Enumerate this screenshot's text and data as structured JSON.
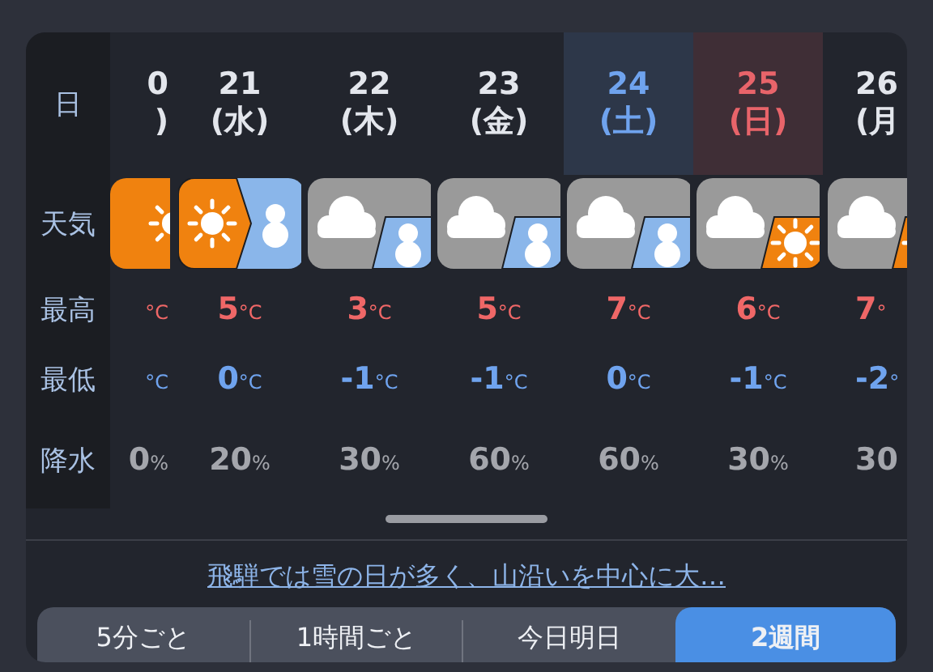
{
  "row_labels": {
    "date": "日",
    "weather": "天気",
    "high": "最高",
    "low": "最低",
    "precip": "降水"
  },
  "days": [
    {
      "day": "0",
      "weekday": ")",
      "color": "#e3e6ec",
      "kind": "sun",
      "high_unit": "°C",
      "low_unit": "°C",
      "precip": "0",
      "precip_unit": "%"
    },
    {
      "day": "21",
      "weekday": "(水)",
      "color": "#e3e6ec",
      "kind": "sun-snow",
      "high": "5",
      "high_unit": "°C",
      "low": "0",
      "low_unit": "°C",
      "precip": "20",
      "precip_unit": "%"
    },
    {
      "day": "22",
      "weekday": "(木)",
      "color": "#e3e6ec",
      "kind": "cloud-snow",
      "high": "3",
      "high_unit": "°C",
      "low": "-1",
      "low_unit": "°C",
      "precip": "30",
      "precip_unit": "%"
    },
    {
      "day": "23",
      "weekday": "(金)",
      "color": "#e3e6ec",
      "kind": "cloud-snow",
      "high": "5",
      "high_unit": "°C",
      "low": "-1",
      "low_unit": "°C",
      "precip": "60",
      "precip_unit": "%"
    },
    {
      "day": "24",
      "weekday": "(土)",
      "color": "#6fa3ee",
      "kind": "cloud-snow",
      "high": "7",
      "high_unit": "°C",
      "low": "0",
      "low_unit": "°C",
      "precip": "60",
      "precip_unit": "%"
    },
    {
      "day": "25",
      "weekday": "(日)",
      "color": "#e8646a",
      "kind": "cloud-sun",
      "high": "6",
      "high_unit": "°C",
      "low": "-1",
      "low_unit": "°C",
      "precip": "30",
      "precip_unit": "%"
    },
    {
      "day": "26",
      "weekday": "(月",
      "color": "#e3e6ec",
      "kind": "cloud-sun",
      "high": "7",
      "high_unit": "°",
      "low": "-2",
      "low_unit": "°",
      "precip": "30"
    }
  ],
  "summary_link": "飛騨では雪の日が多く、山沿いを中心に大…",
  "range_tabs": [
    {
      "label": "5分ごと",
      "selected": false
    },
    {
      "label": "1時間ごと",
      "selected": false
    },
    {
      "label": "今日明日",
      "selected": false
    },
    {
      "label": "2週間",
      "selected": true
    }
  ]
}
